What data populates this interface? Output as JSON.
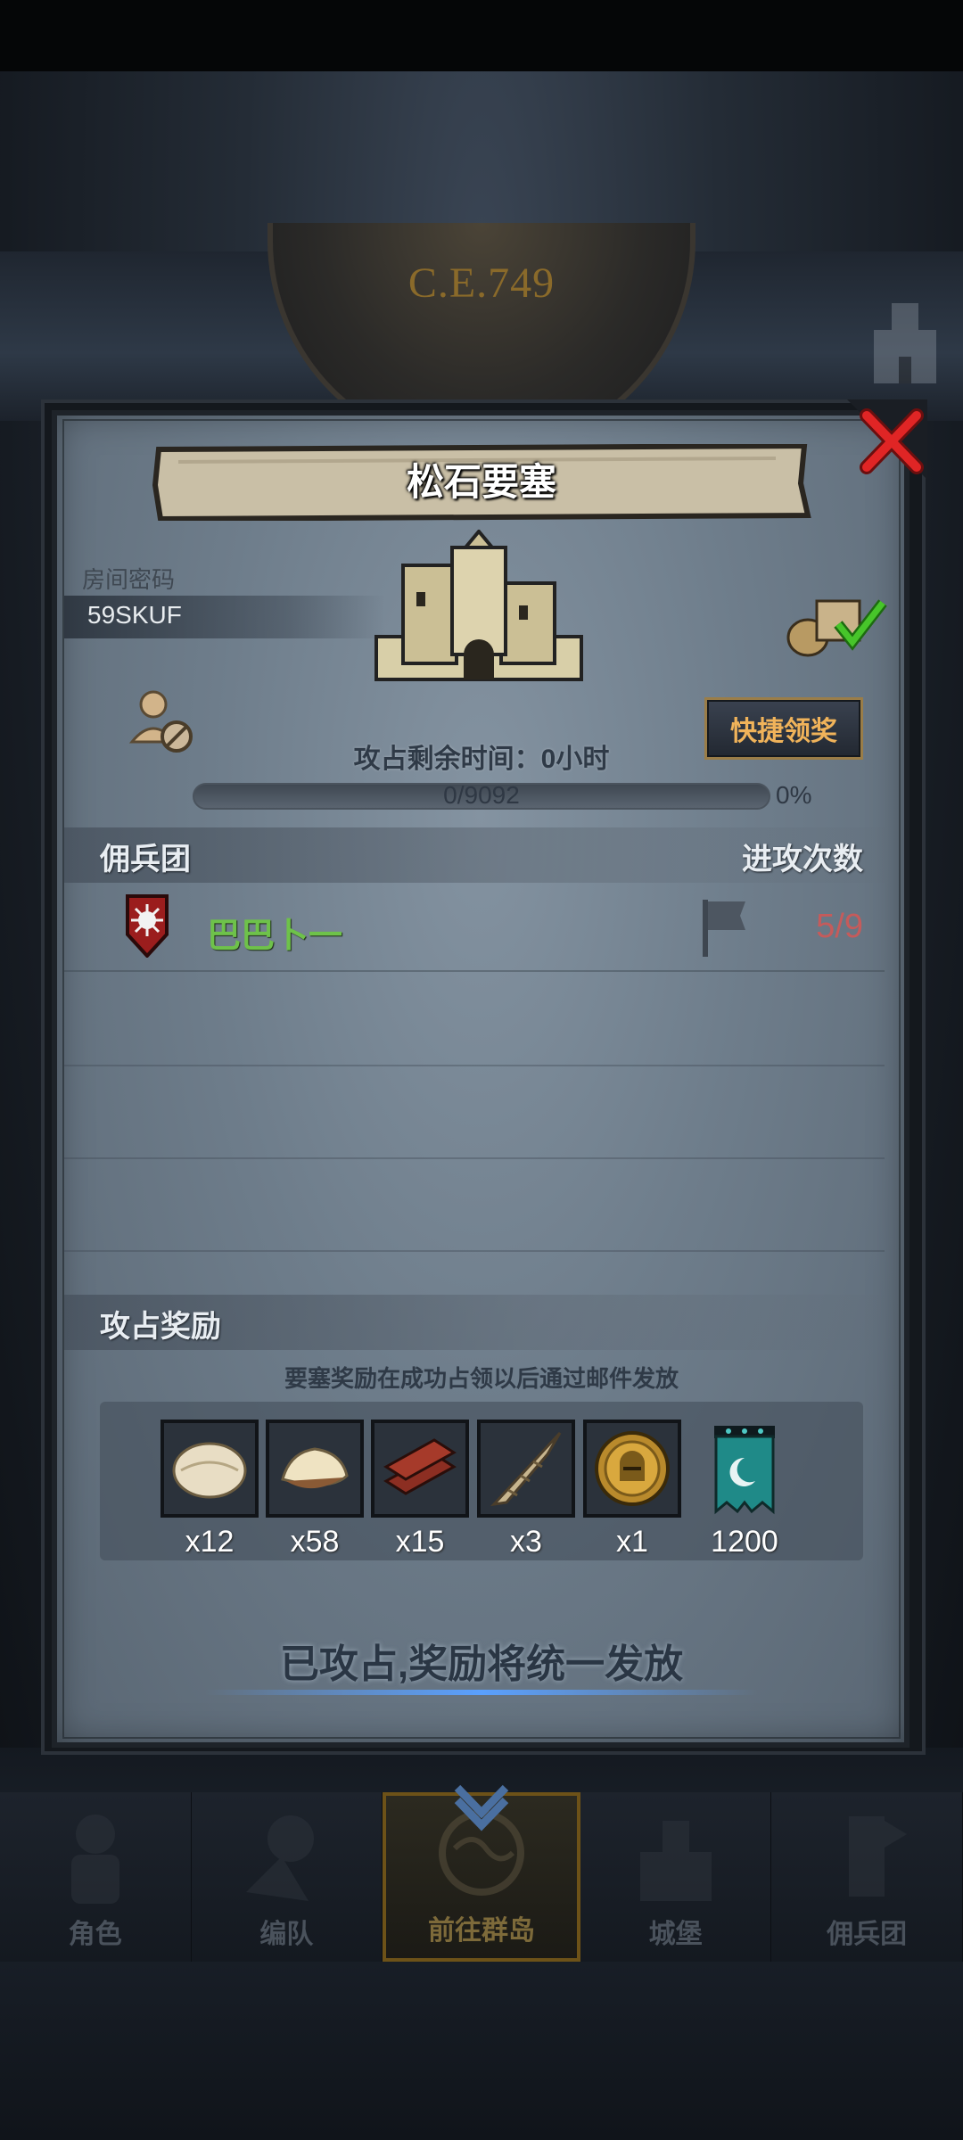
{
  "background": {
    "era_label": "C.E.749"
  },
  "modal": {
    "title": "松石要塞",
    "room_label": "房间密码",
    "room_code": "59SKUF",
    "quick_claim_label": "快捷领奖",
    "remaining_time": "攻占剩余时间：0小时",
    "progress": {
      "text": "0/9092",
      "percent": "0%",
      "fraction": 0
    },
    "mercenary_header": "佣兵团",
    "attack_header": "进攻次数",
    "guilds": [
      {
        "name": "巴巴卜一",
        "attacks": "5/9"
      }
    ],
    "reward_header": "攻占奖励",
    "reward_note": "要塞奖励在成功占领以后通过邮件发放",
    "rewards": [
      {
        "icon": "fleece-icon",
        "qty": "x12"
      },
      {
        "icon": "hide-icon",
        "qty": "x58"
      },
      {
        "icon": "wood-planks-icon",
        "qty": "x15"
      },
      {
        "icon": "horn-icon",
        "qty": "x3"
      },
      {
        "icon": "knight-medal-icon",
        "qty": "x1"
      },
      {
        "icon": "guild-banner-icon",
        "qty": "1200"
      }
    ],
    "status_message": "已攻占,奖励将统一发放"
  },
  "bottom_nav": [
    {
      "label": "角色",
      "icon": "knight-icon"
    },
    {
      "label": "编队",
      "icon": "formation-icon"
    },
    {
      "label": "前往群岛",
      "icon": "globe-icon",
      "active": true
    },
    {
      "label": "城堡",
      "icon": "castle-icon"
    },
    {
      "label": "佣兵团",
      "icon": "mercenary-icon"
    }
  ],
  "colors": {
    "accent_gold": "#f0b35a",
    "guild_green": "#6ec24a",
    "attack_red": "#c55b5b"
  }
}
